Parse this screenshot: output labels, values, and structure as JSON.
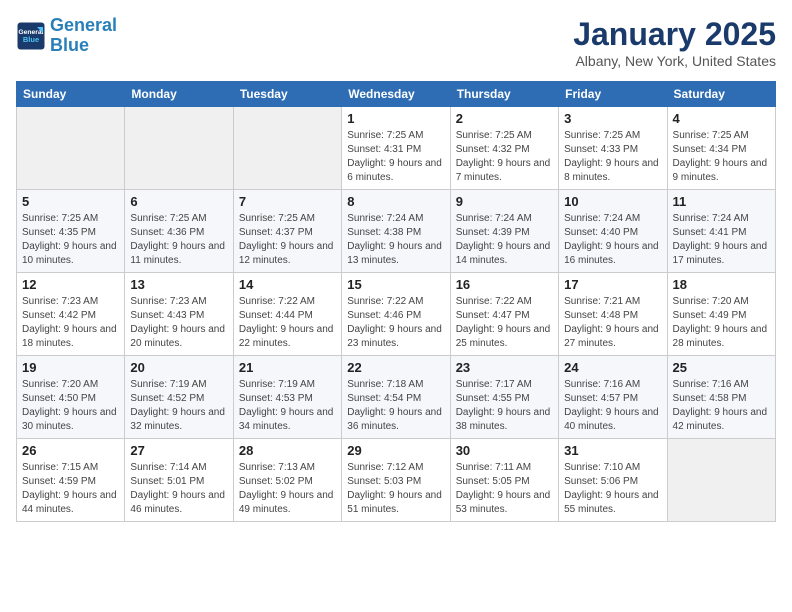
{
  "header": {
    "logo_line1": "General",
    "logo_line2": "Blue",
    "month": "January 2025",
    "location": "Albany, New York, United States"
  },
  "days_of_week": [
    "Sunday",
    "Monday",
    "Tuesday",
    "Wednesday",
    "Thursday",
    "Friday",
    "Saturday"
  ],
  "weeks": [
    [
      {
        "day": "",
        "info": ""
      },
      {
        "day": "",
        "info": ""
      },
      {
        "day": "",
        "info": ""
      },
      {
        "day": "1",
        "info": "Sunrise: 7:25 AM\nSunset: 4:31 PM\nDaylight: 9 hours and 6 minutes."
      },
      {
        "day": "2",
        "info": "Sunrise: 7:25 AM\nSunset: 4:32 PM\nDaylight: 9 hours and 7 minutes."
      },
      {
        "day": "3",
        "info": "Sunrise: 7:25 AM\nSunset: 4:33 PM\nDaylight: 9 hours and 8 minutes."
      },
      {
        "day": "4",
        "info": "Sunrise: 7:25 AM\nSunset: 4:34 PM\nDaylight: 9 hours and 9 minutes."
      }
    ],
    [
      {
        "day": "5",
        "info": "Sunrise: 7:25 AM\nSunset: 4:35 PM\nDaylight: 9 hours and 10 minutes."
      },
      {
        "day": "6",
        "info": "Sunrise: 7:25 AM\nSunset: 4:36 PM\nDaylight: 9 hours and 11 minutes."
      },
      {
        "day": "7",
        "info": "Sunrise: 7:25 AM\nSunset: 4:37 PM\nDaylight: 9 hours and 12 minutes."
      },
      {
        "day": "8",
        "info": "Sunrise: 7:24 AM\nSunset: 4:38 PM\nDaylight: 9 hours and 13 minutes."
      },
      {
        "day": "9",
        "info": "Sunrise: 7:24 AM\nSunset: 4:39 PM\nDaylight: 9 hours and 14 minutes."
      },
      {
        "day": "10",
        "info": "Sunrise: 7:24 AM\nSunset: 4:40 PM\nDaylight: 9 hours and 16 minutes."
      },
      {
        "day": "11",
        "info": "Sunrise: 7:24 AM\nSunset: 4:41 PM\nDaylight: 9 hours and 17 minutes."
      }
    ],
    [
      {
        "day": "12",
        "info": "Sunrise: 7:23 AM\nSunset: 4:42 PM\nDaylight: 9 hours and 18 minutes."
      },
      {
        "day": "13",
        "info": "Sunrise: 7:23 AM\nSunset: 4:43 PM\nDaylight: 9 hours and 20 minutes."
      },
      {
        "day": "14",
        "info": "Sunrise: 7:22 AM\nSunset: 4:44 PM\nDaylight: 9 hours and 22 minutes."
      },
      {
        "day": "15",
        "info": "Sunrise: 7:22 AM\nSunset: 4:46 PM\nDaylight: 9 hours and 23 minutes."
      },
      {
        "day": "16",
        "info": "Sunrise: 7:22 AM\nSunset: 4:47 PM\nDaylight: 9 hours and 25 minutes."
      },
      {
        "day": "17",
        "info": "Sunrise: 7:21 AM\nSunset: 4:48 PM\nDaylight: 9 hours and 27 minutes."
      },
      {
        "day": "18",
        "info": "Sunrise: 7:20 AM\nSunset: 4:49 PM\nDaylight: 9 hours and 28 minutes."
      }
    ],
    [
      {
        "day": "19",
        "info": "Sunrise: 7:20 AM\nSunset: 4:50 PM\nDaylight: 9 hours and 30 minutes."
      },
      {
        "day": "20",
        "info": "Sunrise: 7:19 AM\nSunset: 4:52 PM\nDaylight: 9 hours and 32 minutes."
      },
      {
        "day": "21",
        "info": "Sunrise: 7:19 AM\nSunset: 4:53 PM\nDaylight: 9 hours and 34 minutes."
      },
      {
        "day": "22",
        "info": "Sunrise: 7:18 AM\nSunset: 4:54 PM\nDaylight: 9 hours and 36 minutes."
      },
      {
        "day": "23",
        "info": "Sunrise: 7:17 AM\nSunset: 4:55 PM\nDaylight: 9 hours and 38 minutes."
      },
      {
        "day": "24",
        "info": "Sunrise: 7:16 AM\nSunset: 4:57 PM\nDaylight: 9 hours and 40 minutes."
      },
      {
        "day": "25",
        "info": "Sunrise: 7:16 AM\nSunset: 4:58 PM\nDaylight: 9 hours and 42 minutes."
      }
    ],
    [
      {
        "day": "26",
        "info": "Sunrise: 7:15 AM\nSunset: 4:59 PM\nDaylight: 9 hours and 44 minutes."
      },
      {
        "day": "27",
        "info": "Sunrise: 7:14 AM\nSunset: 5:01 PM\nDaylight: 9 hours and 46 minutes."
      },
      {
        "day": "28",
        "info": "Sunrise: 7:13 AM\nSunset: 5:02 PM\nDaylight: 9 hours and 49 minutes."
      },
      {
        "day": "29",
        "info": "Sunrise: 7:12 AM\nSunset: 5:03 PM\nDaylight: 9 hours and 51 minutes."
      },
      {
        "day": "30",
        "info": "Sunrise: 7:11 AM\nSunset: 5:05 PM\nDaylight: 9 hours and 53 minutes."
      },
      {
        "day": "31",
        "info": "Sunrise: 7:10 AM\nSunset: 5:06 PM\nDaylight: 9 hours and 55 minutes."
      },
      {
        "day": "",
        "info": ""
      }
    ]
  ]
}
